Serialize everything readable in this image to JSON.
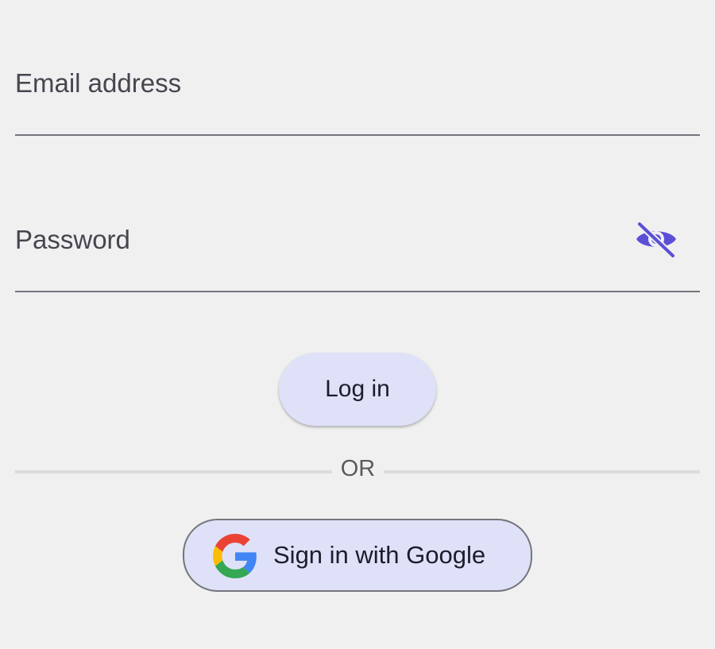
{
  "form": {
    "email": {
      "placeholder": "Email address",
      "value": ""
    },
    "password": {
      "placeholder": "Password",
      "value": "",
      "visibility_icon": "eye-off-icon"
    },
    "login_button_label": "Log in",
    "divider_text": "OR",
    "google_button_label": "Sign in with Google",
    "google_icon": "google-logo-icon"
  },
  "colors": {
    "background": "#f0f0f0",
    "button_fill": "#dfe1f8",
    "accent": "#5b4fd8",
    "field_underline": "#74757c",
    "text_primary": "#1b1d2c",
    "text_secondary": "#45464f"
  }
}
